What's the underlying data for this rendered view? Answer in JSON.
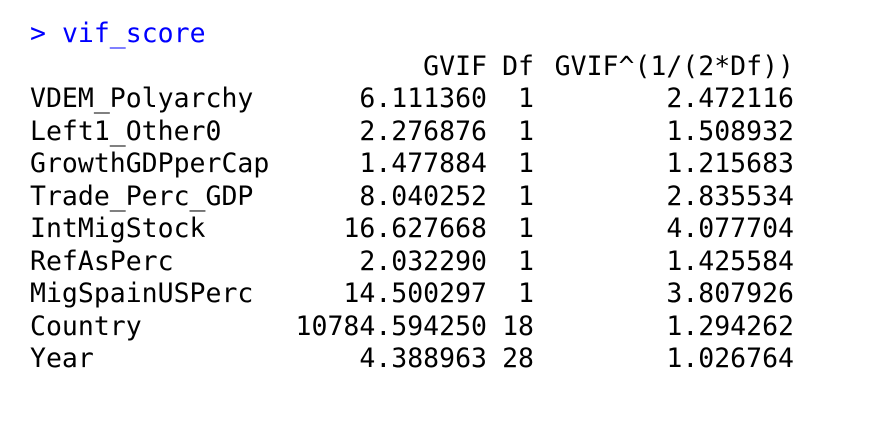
{
  "console": {
    "prompt_symbol": ">",
    "command": "vif_score"
  },
  "table": {
    "headers": [
      "GVIF",
      "Df",
      "GVIF^(1/(2*Df))"
    ],
    "rows": [
      {
        "name": "VDEM_Polyarchy",
        "gvif": "6.111360",
        "df": "1",
        "adj": "2.472116"
      },
      {
        "name": "Left1_Other0",
        "gvif": "2.276876",
        "df": "1",
        "adj": "1.508932"
      },
      {
        "name": "GrowthGDPperCap",
        "gvif": "1.477884",
        "df": "1",
        "adj": "1.215683"
      },
      {
        "name": "Trade_Perc_GDP",
        "gvif": "8.040252",
        "df": "1",
        "adj": "2.835534"
      },
      {
        "name": "IntMigStock",
        "gvif": "16.627668",
        "df": "1",
        "adj": "4.077704"
      },
      {
        "name": "RefAsPerc",
        "gvif": "2.032290",
        "df": "1",
        "adj": "1.425584"
      },
      {
        "name": "MigSpainUSPerc",
        "gvif": "14.500297",
        "df": "1",
        "adj": "3.807926"
      },
      {
        "name": "Country",
        "gvif": "10784.594250",
        "df": "18",
        "adj": "1.294262"
      },
      {
        "name": "Year",
        "gvif": "4.388963",
        "df": "28",
        "adj": "1.026764"
      }
    ]
  },
  "colors": {
    "prompt": "#0000ff",
    "output": "#000000",
    "background": "#ffffff"
  }
}
